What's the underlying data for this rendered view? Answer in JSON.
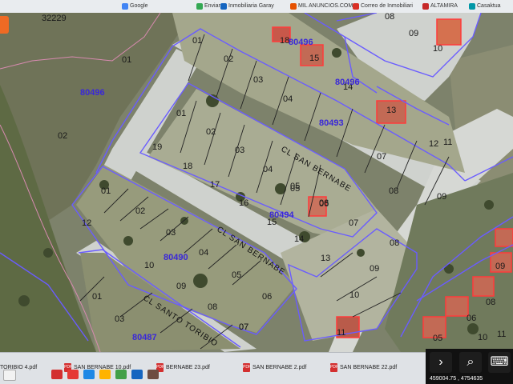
{
  "browser": {
    "tabs": [
      {
        "label": "Google",
        "color": "#4285f4"
      },
      {
        "label": "Enviar",
        "color": "#34a853"
      },
      {
        "label": "Inmobiliaria Garay",
        "color": "#1565c0"
      },
      {
        "label": "MIL ANUNCIOS.COM",
        "color": "#e65100"
      },
      {
        "label": "Correo de Inmobiliari",
        "color": "#d93025"
      },
      {
        "label": "ALTAMIRA",
        "color": "#c62828"
      },
      {
        "label": "Casaktua",
        "color": "#0097a7"
      }
    ]
  },
  "map": {
    "parcel_refs": [
      "32229",
      "80496",
      "80496",
      "80496",
      "80493",
      "80494",
      "80490",
      "80487"
    ],
    "parcel_numbers": [
      "01",
      "02",
      "01",
      "02",
      "03",
      "04",
      "18",
      "15",
      "14",
      "13",
      "08",
      "09",
      "10",
      "12",
      "11",
      "01",
      "02",
      "03",
      "04",
      "05",
      "06",
      "07",
      "08",
      "09",
      "19",
      "18",
      "17",
      "16",
      "15",
      "14",
      "13",
      "05",
      "06",
      "07",
      "08",
      "09",
      "10",
      "11",
      "01",
      "02",
      "03",
      "04",
      "05",
      "06",
      "07",
      "12",
      "10",
      "09",
      "08",
      "07",
      "01",
      "03",
      "05",
      "06",
      "08",
      "09",
      "10",
      "11"
    ],
    "streets": [
      "CL SAN BERNABE",
      "CL SAN BERNABE",
      "CL SANTO TORIBIO"
    ],
    "parcel_fill": "#9aa184",
    "boundary_color": "#6a5cff",
    "road_color": "#c9ccc8"
  },
  "downloads": [
    {
      "label": "TORIBIO 4.pdf"
    },
    {
      "label": "SAN BERNABE 10.pdf"
    },
    {
      "label": "BERNABE 23.pdf"
    },
    {
      "label": "SAN BERNABE 2.pdf"
    },
    {
      "label": "SAN BERNABE 22.pdf"
    }
  ],
  "controls": {
    "next_icon": "chevron-right-icon",
    "search_icon": "search-icon",
    "keyboard_icon": "keyboard-icon",
    "coordinates": "459004.75 , 4754635"
  },
  "side_tab": {
    "label": "",
    "color": "#ef6a24"
  }
}
